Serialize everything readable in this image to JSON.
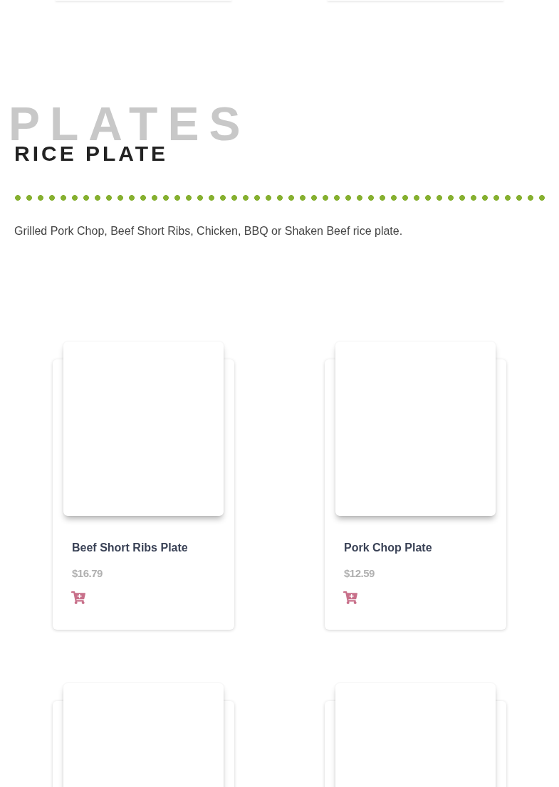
{
  "section": {
    "backdrop_title": "PLATES",
    "title": "RICE PLATE",
    "description": "Grilled Pork Chop, Beef Short Ribs, Chicken, BBQ or Shaken Beef rice plate."
  },
  "products": [
    {
      "kind": "product",
      "name": "Beef Short Ribs Plate",
      "price": "$16.79"
    },
    {
      "kind": "product",
      "name": "Pork Chop Plate",
      "price": "$12.59"
    },
    {
      "kind": "cut_off"
    },
    {
      "kind": "cut_off"
    }
  ]
}
